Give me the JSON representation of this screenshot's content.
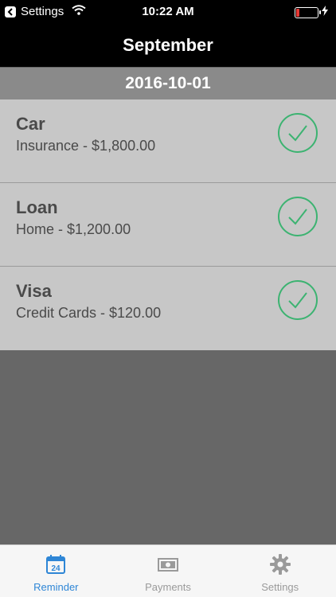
{
  "status_bar": {
    "back_app": "Settings",
    "time": "10:22 AM"
  },
  "nav": {
    "title": "September"
  },
  "section": {
    "date": "2016-10-01"
  },
  "reminders": [
    {
      "title": "Car",
      "subtitle": "Insurance - $1,800.00",
      "icon": "checkmark-circle-icon"
    },
    {
      "title": "Loan",
      "subtitle": "Home - $1,200.00",
      "icon": "checkmark-circle-icon"
    },
    {
      "title": "Visa",
      "subtitle": "Credit Cards - $120.00",
      "icon": "checkmark-circle-icon"
    }
  ],
  "tabs": [
    {
      "label": "Reminder",
      "icon": "calendar-icon",
      "calendar_day": "24",
      "active": true
    },
    {
      "label": "Payments",
      "icon": "money-icon",
      "active": false
    },
    {
      "label": "Settings",
      "icon": "gear-icon",
      "active": false
    }
  ],
  "colors": {
    "accent": "#2e86d6",
    "check": "#3cb371",
    "battery_low": "#e53935"
  }
}
